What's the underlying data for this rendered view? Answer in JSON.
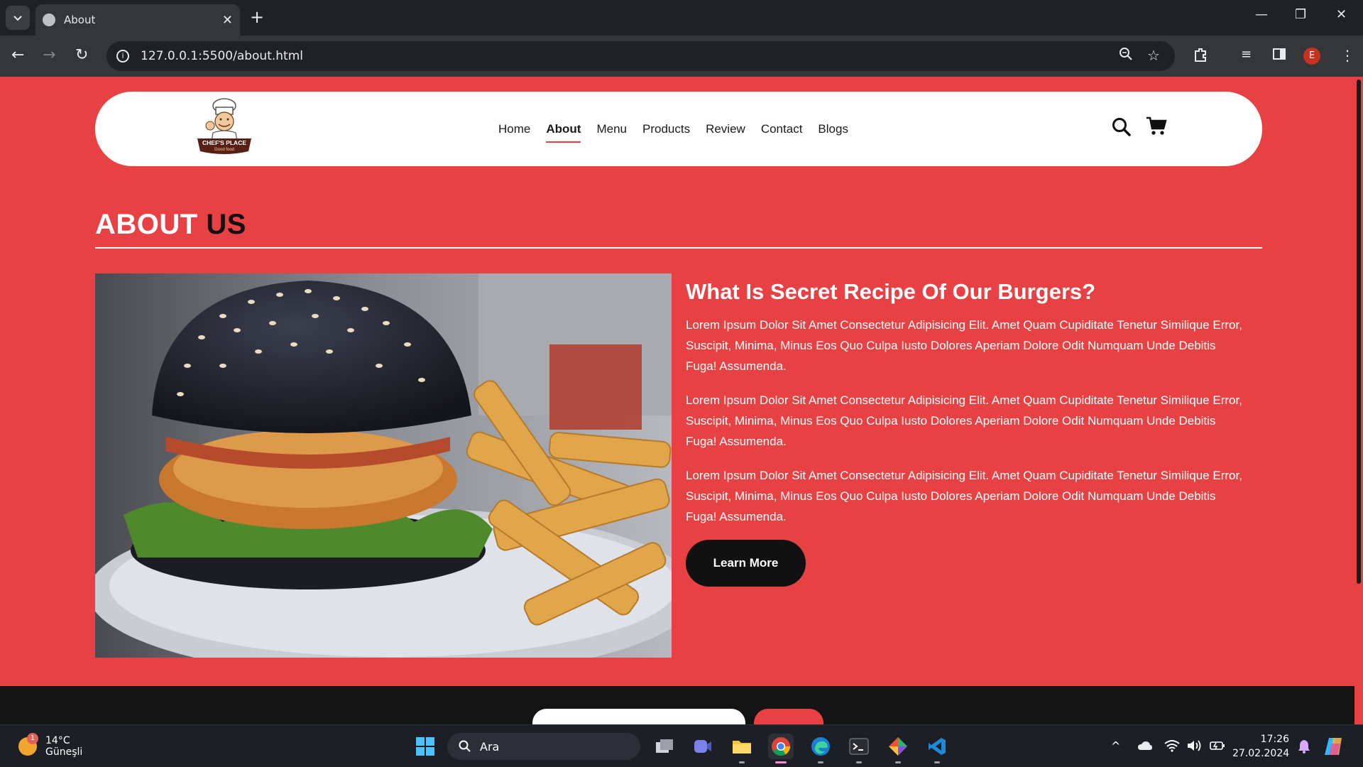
{
  "browser": {
    "tab_title": "About",
    "url": "127.0.0.1:5500/about.html",
    "profile_initial": "E"
  },
  "header": {
    "logo": {
      "name": "CHEF'S PLACE",
      "tagline": "Good food"
    },
    "nav": [
      "Home",
      "About",
      "Menu",
      "Products",
      "Review",
      "Contact",
      "Blogs"
    ],
    "active_nav": "About"
  },
  "about": {
    "title_part1": "ABOUT",
    "title_part2": "US",
    "heading": "What Is Secret Recipe Of Our Burgers?",
    "paragraphs": [
      "Lorem Ipsum Dolor Sit Amet Consectetur Adipisicing Elit. Amet Quam Cupiditate Tenetur Similique Error, Suscipit, Minima, Minus Eos Quo Culpa Iusto Dolores Aperiam Dolore Odit Numquam Unde Debitis Fuga! Assumenda.",
      "Lorem Ipsum Dolor Sit Amet Consectetur Adipisicing Elit. Amet Quam Cupiditate Tenetur Similique Error, Suscipit, Minima, Minus Eos Quo Culpa Iusto Dolores Aperiam Dolore Odit Numquam Unde Debitis Fuga! Assumenda.",
      "Lorem Ipsum Dolor Sit Amet Consectetur Adipisicing Elit. Amet Quam Cupiditate Tenetur Similique Error, Suscipit, Minima, Minus Eos Quo Culpa Iusto Dolores Aperiam Dolore Odit Numquam Unde Debitis Fuga! Assumenda."
    ],
    "button_label": "Learn More"
  },
  "taskbar": {
    "weather_temp": "14°C",
    "weather_desc": "Güneşli",
    "weather_badge": "1",
    "search_label": "Ara",
    "time": "17:26",
    "date": "27.02.2024"
  },
  "colors": {
    "page_bg": "#e84143",
    "dark": "#111111",
    "white": "#ffffff"
  }
}
